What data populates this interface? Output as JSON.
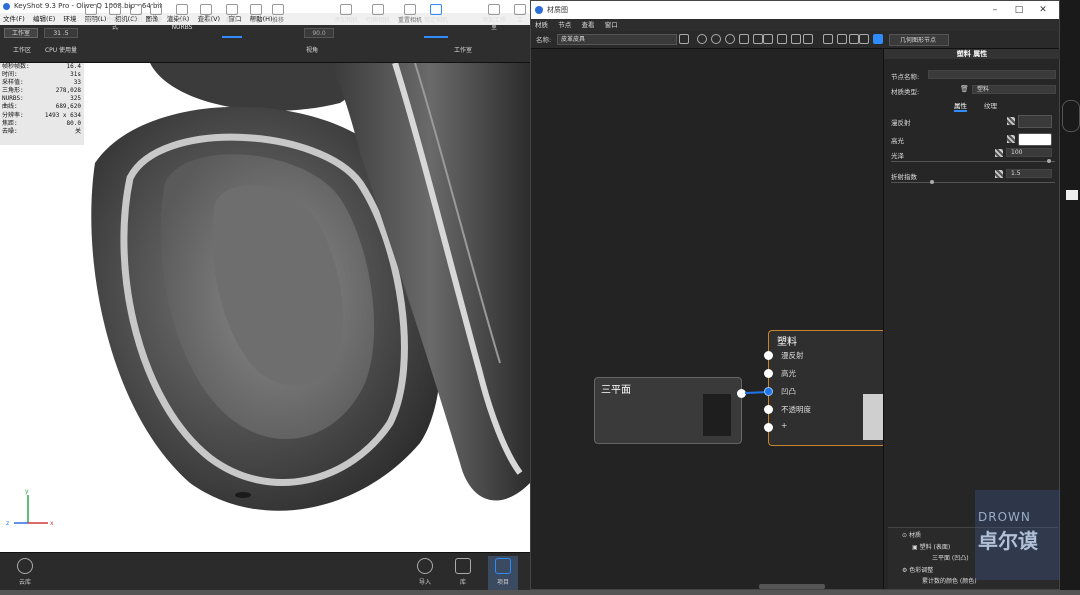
{
  "keyshot": {
    "title": "KeyShot 9.3 Pro  -  Olive Q 1008.bip  -  64 bit",
    "menu": [
      "文件(F)",
      "编辑(E)",
      "环境",
      "照明(L)",
      "相机(C)",
      "图像",
      "渲染(R)",
      "查看(V)",
      "窗口",
      "帮助(H)"
    ],
    "toolbar": {
      "workspace_pill": "工作室",
      "spin_value": "31 .5",
      "spin2_value": "90.0",
      "buttons": [
        "工作区",
        "CPU 使用量",
        "暂停",
        "性能模式",
        "GPU",
        "去噪",
        "渲染 NURBS",
        "区域",
        "翻滚",
        "平移",
        "推移",
        "视角",
        "添加相机",
        "切换相机",
        "重置相机",
        "锁定相机",
        "工作室",
        "添加工作室",
        "工"
      ]
    },
    "stats": [
      {
        "label": "帧秒帧数:",
        "value": "16.4"
      },
      {
        "label": "时间:",
        "value": "31s"
      },
      {
        "label": "采样值:",
        "value": "33"
      },
      {
        "label": "三角形:",
        "value": "278,028"
      },
      {
        "label": "NURBS:",
        "value": "325"
      },
      {
        "label": "曲线:",
        "value": "689,620"
      },
      {
        "label": "分辨率:",
        "value": "1493 x 634"
      },
      {
        "label": "焦距:",
        "value": "80.0"
      },
      {
        "label": "去噪:",
        "value": "关"
      }
    ],
    "axis": {
      "y": "y",
      "z": "z",
      "x": "x"
    },
    "bottom": {
      "cloud": "云库",
      "import": "导入",
      "library": "库",
      "project": "项目"
    }
  },
  "material_graph": {
    "title": "材质图",
    "menu": [
      "材质",
      "节点",
      "查看",
      "窗口"
    ],
    "name_label": "名称:",
    "name_value": "皮革皮具",
    "geometry_tab": "几何图形节点",
    "nodes": {
      "triplanar": {
        "title": "三平面"
      },
      "plastic": {
        "title": "塑料",
        "ports": [
          "漫反射",
          "高光",
          "凹凸",
          "不透明度",
          "+"
        ]
      }
    },
    "properties": {
      "header": "塑料  属性",
      "node_name_label": "节点名称:",
      "node_name_value": "",
      "material_type_label": "材质类型:",
      "material_type_value": "塑料",
      "tabs": [
        "属性",
        "纹理"
      ],
      "diffuse_label": "漫反射",
      "specular_label": "高光",
      "roughness_label": "光泽",
      "roughness_value": "100",
      "refraction_label": "折射指数",
      "refraction_value": "1.5",
      "colors": {
        "diffuse": "#3a3a3a",
        "specular": "#ffffff"
      }
    },
    "tree": {
      "root": "材质",
      "items": [
        "塑料 (表面)",
        "三平面 (凹凸)",
        "色彩调整",
        "累计数的颜色 (颜色)"
      ]
    }
  },
  "watermark": {
    "line1": "DROWN",
    "line2": "卓尔谟"
  }
}
